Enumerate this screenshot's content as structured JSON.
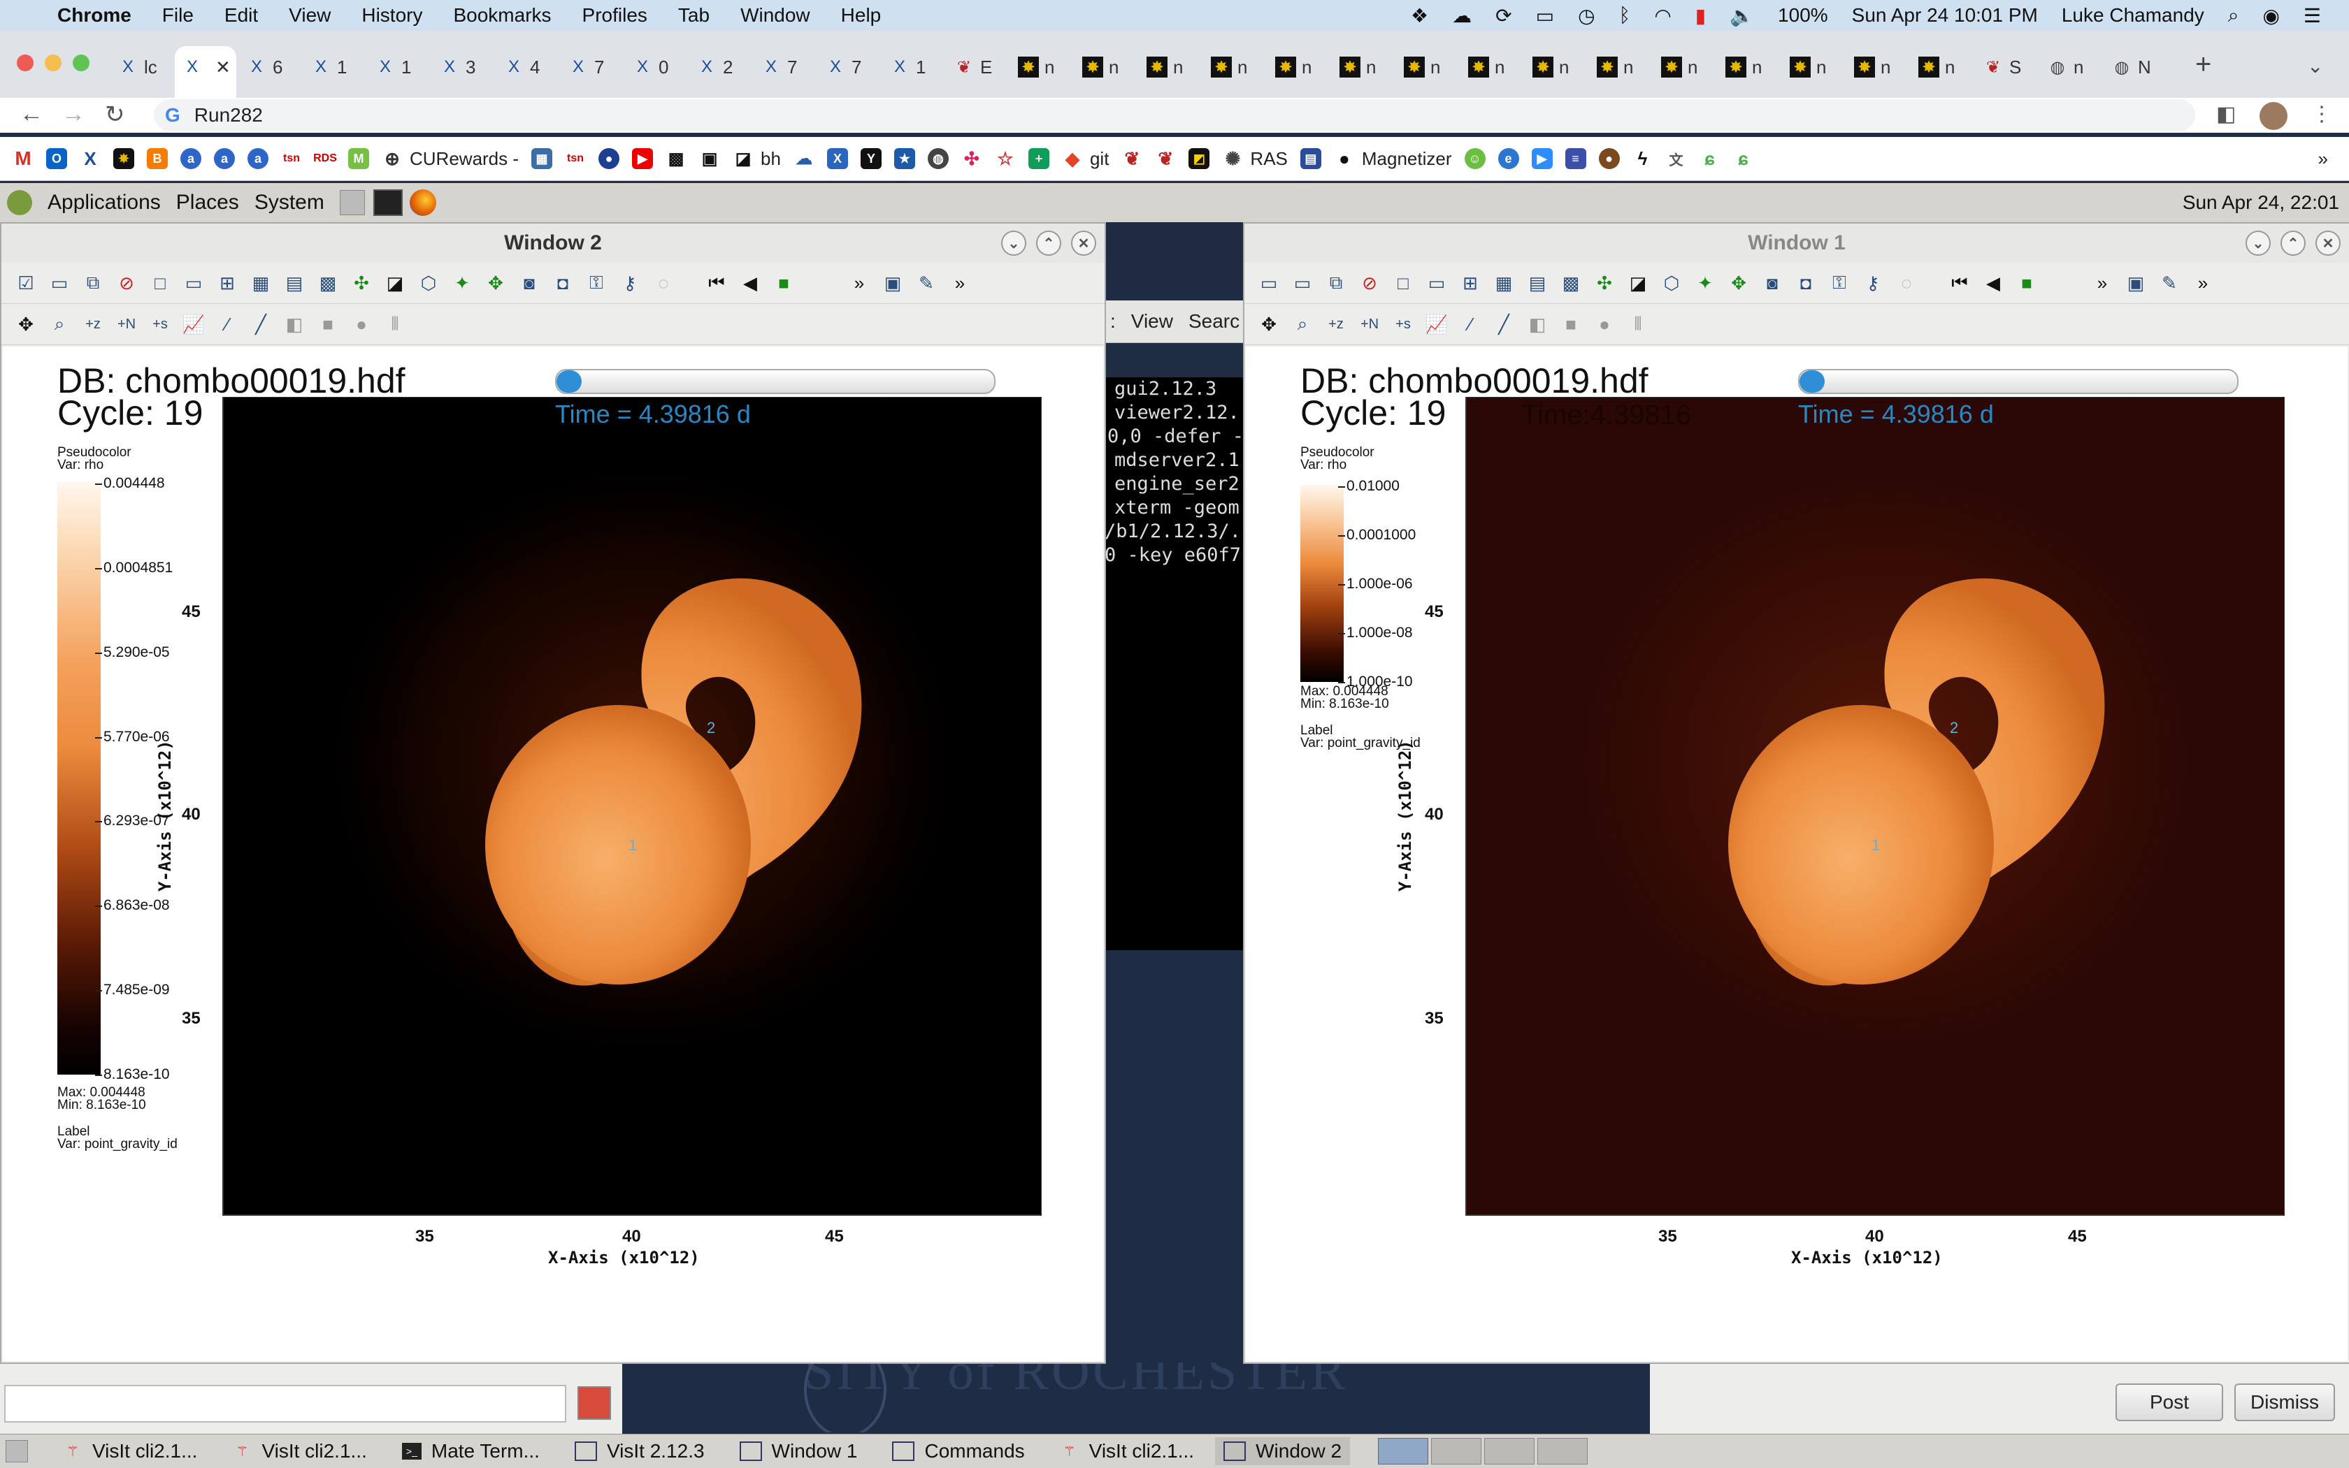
{
  "menubar": {
    "items": [
      "Chrome",
      "File",
      "Edit",
      "View",
      "History",
      "Bookmarks",
      "Profiles",
      "Tab",
      "Window",
      "Help"
    ],
    "battery": "100%",
    "datetime": "Sun Apr 24  10:01 PM",
    "user": "Luke Chamandy"
  },
  "tabs": [
    {
      "label": "lc"
    },
    {
      "label": ""
    },
    {
      "label": "6"
    },
    {
      "label": "1"
    },
    {
      "label": "1"
    },
    {
      "label": "3"
    },
    {
      "label": "4"
    },
    {
      "label": "7"
    },
    {
      "label": "0"
    },
    {
      "label": "2"
    },
    {
      "label": "7"
    },
    {
      "label": "7"
    },
    {
      "label": "1"
    },
    {
      "label": "E"
    },
    {
      "label": "n"
    },
    {
      "label": "n"
    },
    {
      "label": "n"
    },
    {
      "label": "n"
    },
    {
      "label": "n"
    },
    {
      "label": "n"
    },
    {
      "label": "n"
    },
    {
      "label": "n"
    },
    {
      "label": "n"
    },
    {
      "label": "n"
    },
    {
      "label": "n"
    },
    {
      "label": "n"
    },
    {
      "label": "n"
    },
    {
      "label": "n"
    },
    {
      "label": "n"
    },
    {
      "label": "S"
    },
    {
      "label": "n"
    },
    {
      "label": "N"
    }
  ],
  "address": {
    "url": "Run282"
  },
  "bookmarks": [
    {
      "label": "CURewards -"
    },
    {
      "label": "bh"
    },
    {
      "label": "git"
    },
    {
      "label": "RAS"
    },
    {
      "label": "Magnetizer"
    }
  ],
  "gnome_panel": {
    "menus": [
      "Applications",
      "Places",
      "System"
    ],
    "clock": "Sun Apr 24, 22:01"
  },
  "window2": {
    "title": "Window 2",
    "db": "DB: chombo00019.hdf",
    "cycle": "Cycle: 19",
    "time": "Time = 4.39816 d",
    "legend": {
      "type": "Pseudocolor",
      "var": "Var: rho",
      "ticks": [
        "0.004448",
        "0.0004851",
        "5.290e-05",
        "5.770e-06",
        "6.293e-07",
        "6.863e-08",
        "7.485e-09",
        "8.163e-10"
      ],
      "max": "Max:  0.004448",
      "min": "Min:  8.163e-10",
      "label": "Label",
      "label_var": "Var: point_gravity_id"
    },
    "xaxis": {
      "label": "X-Axis (x10^12)",
      "ticks": [
        "35",
        "40",
        "45"
      ]
    },
    "yaxis": {
      "label": "Y-Axis (x10^12)",
      "ticks": [
        "45",
        "40",
        "35"
      ]
    },
    "points": [
      "1",
      "2"
    ]
  },
  "window1": {
    "title": "Window 1",
    "db": "DB: chombo00019.hdf",
    "cycle": "Cycle: 19",
    "time_ghost": "Time:4.39816",
    "time": "Time = 4.39816 d",
    "legend": {
      "type": "Pseudocolor",
      "var": "Var: rho",
      "ticks": [
        "0.01000",
        "0.0001000",
        "1.000e-06",
        "1.000e-08",
        "1.000e-10"
      ],
      "max": "Max:  0.004448",
      "min": "Min:  8.163e-10",
      "label": "Label",
      "label_var": "Var: point_gravity_id"
    },
    "xaxis": {
      "label": "X-Axis (x10^12)",
      "ticks": [
        "35",
        "40",
        "45"
      ]
    },
    "yaxis": {
      "label": "Y-Axis (x10^12)",
      "ticks": [
        "45",
        "40",
        "35"
      ]
    },
    "points": [
      "1",
      "2"
    ]
  },
  "terminal": {
    "menu": [
      "View",
      "Searc"
    ],
    "lines": [
      "gui2.12.3",
      "viewer2.12.",
      "0,0 -defer -",
      "mdserver2.1",
      "engine_ser2",
      "xterm -geom",
      "/b1/2.12.3/.",
      "0 -key e60f7"
    ]
  },
  "background_text": "SITY of ROCHESTER",
  "buttons": {
    "post": "Post",
    "dismiss": "Dismiss"
  },
  "taskbar": [
    {
      "label": "VisIt cli2.1..."
    },
    {
      "label": "VisIt cli2.1..."
    },
    {
      "label": "Mate Term..."
    },
    {
      "label": "VisIt 2.12.3"
    },
    {
      "label": "Window 1"
    },
    {
      "label": "Commands"
    },
    {
      "label": "VisIt cli2.1..."
    },
    {
      "label": "Window 2"
    }
  ],
  "colors": {
    "bg_dark": "#1e2c44",
    "plot_bg_w1": "#2a0805",
    "time_blue": "#2b87c4"
  }
}
